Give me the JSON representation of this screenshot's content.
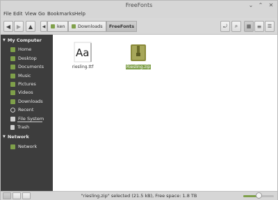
{
  "window": {
    "title": "FreeFonts",
    "controls": {
      "minimize": "⌄",
      "maximize": "⌃",
      "close": "✕"
    }
  },
  "menubar": [
    "File",
    "Edit",
    "View",
    "Go",
    "Bookmarks",
    "Help"
  ],
  "toolbar": {
    "back_icon": "arrow-left-icon",
    "forward_icon": "arrow-right-icon",
    "up_icon": "arrow-up-icon",
    "breadcrumbs": [
      "ken",
      "Downloads",
      "FreeFonts"
    ],
    "active_breadcrumb": "FreeFonts"
  },
  "sidebar": {
    "sections": [
      {
        "header": "My Computer",
        "items": [
          "Home",
          "Desktop",
          "Documents",
          "Music",
          "Pictures",
          "Videos",
          "Downloads",
          "Recent",
          "File System",
          "Trash"
        ]
      },
      {
        "header": "Network",
        "items": [
          "Network"
        ]
      }
    ]
  },
  "files": [
    {
      "name": "riesling.ttf",
      "icon": "font-file-icon",
      "selected": false,
      "preview": "Aa"
    },
    {
      "name": "Riesling.zip",
      "icon": "archive-icon",
      "selected": true
    }
  ],
  "status": {
    "text": "\"riesling.zip\" selected (21.5 kB), Free space: 1.8 TB",
    "zoom": 0.5
  },
  "colors": {
    "accent": "#7fa04a",
    "sidebar_bg": "#3d3d3d",
    "content_bg": "#ffffff"
  }
}
